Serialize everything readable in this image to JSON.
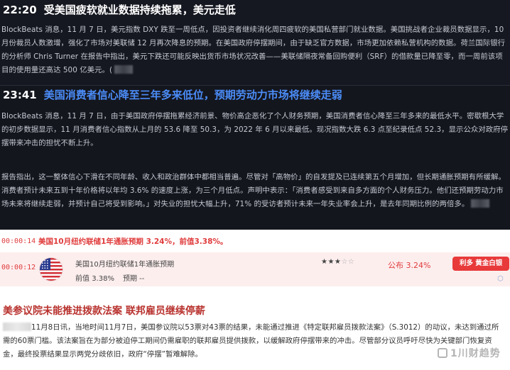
{
  "news": [
    {
      "time": "22:20",
      "title": "受美国疲软就业数据持续拖累，美元走低",
      "paragraphs": [
        "BlockBeats 消息，11 月 7 日，美元指数 DXY 跌至一周低点，因投资者继续消化周四疲软的美国私营部门就业数据。美国挑战者企业裁员数据显示，10 月份裁员人数激增，强化了市场对美联储 12 月再次降息的预期。在美国政府停摆期间，由于缺乏官方数据，市场更加依赖私营机构的数据。荷兰国际银行的分析师 Chris Turner 在报告中指出，美元下跌还可能反映出货币市场状况改善——美联储隔夜常备回购便利（SRF）的借款量已降至零，而一周前该项目的使用量还高达 500 亿美元。("
      ]
    },
    {
      "time": "23:41",
      "title": "美国消费者信心降至三年多来低位，预期劳动力市场将继续走弱",
      "paragraphs": [
        "BlockBeats 消息，11 月 7 日，由于美国政府停摆拖累经济前景、物价高企恶化了个人财务预期，美国消费者信心降至三年多来的最低水平。密歇根大学的初步数据显示，11 月消费者信心指数从上月的 53.6 降至 50.3，为 2022 年 6 月以来最低。现况指数大跌 6.3 点至纪录低点 52.3，显示公众对政府停摆带来冲击的担忧不断上升。",
        "报告指出，这一整体信心下滑在不同年龄、收入和政治群体中都相当普遍。尽管对「高物价」的自发提及已连续第五个月增加，但长期通胀预期有所缓解。消费者预计未来五到十年价格将以年均 3.6% 的速度上涨，为三个月低点。声明中表示：「消费者感受到来自多方面的个人财务压力。他们还预期劳动力市场未来将继续走弱，并预计自己将受到影响。」对失业的担忧大幅上升，71% 的受访者预计未来一年失业率会上升，是去年同期比例的两倍多。"
      ]
    }
  ],
  "flash": {
    "time": "00:00:14",
    "headline": "美国10月纽约联储1年通胀预期 3.24%，前值3.38%。"
  },
  "indicator": {
    "time": "00:00:12",
    "name": "美国10月纽约联储1年通胀预期",
    "prev_label": "前值",
    "prev_value": "3.38%",
    "forecast": "预期 --",
    "stars_on": "★★★",
    "stars_off": "☆☆",
    "actual_label": "公布",
    "actual_value": "3.24%",
    "badge": "利多 黄金白银",
    "icon": "cube-icon"
  },
  "article": {
    "title": "美参议院未能推进拨款法案 联邦雇员继续停薪",
    "body_prefix": "11月8日讯，当地时间11月7日，美国参议院以53票对43票的结果，未能通过推进《特定联邦雇员拨款法案》（S.3012）的动议，未达到通过所需的60票门槛。该法案旨在为部分被迫停工期间仍需雇职的联邦雇员提供拨款，以缓解政府停摆带来的冲击。尽管部分议员呼吁尽快为关键部门恢复资金，最终投票结果显示两党分歧依旧，政府“停摆”暂难解除。"
  },
  "watermark": "1川财趋势",
  "colors": {
    "dark_bg": "#161821",
    "title_blue": "#4b8cf7",
    "accent_red": "#e03c3c",
    "article_red": "#b8322e"
  }
}
